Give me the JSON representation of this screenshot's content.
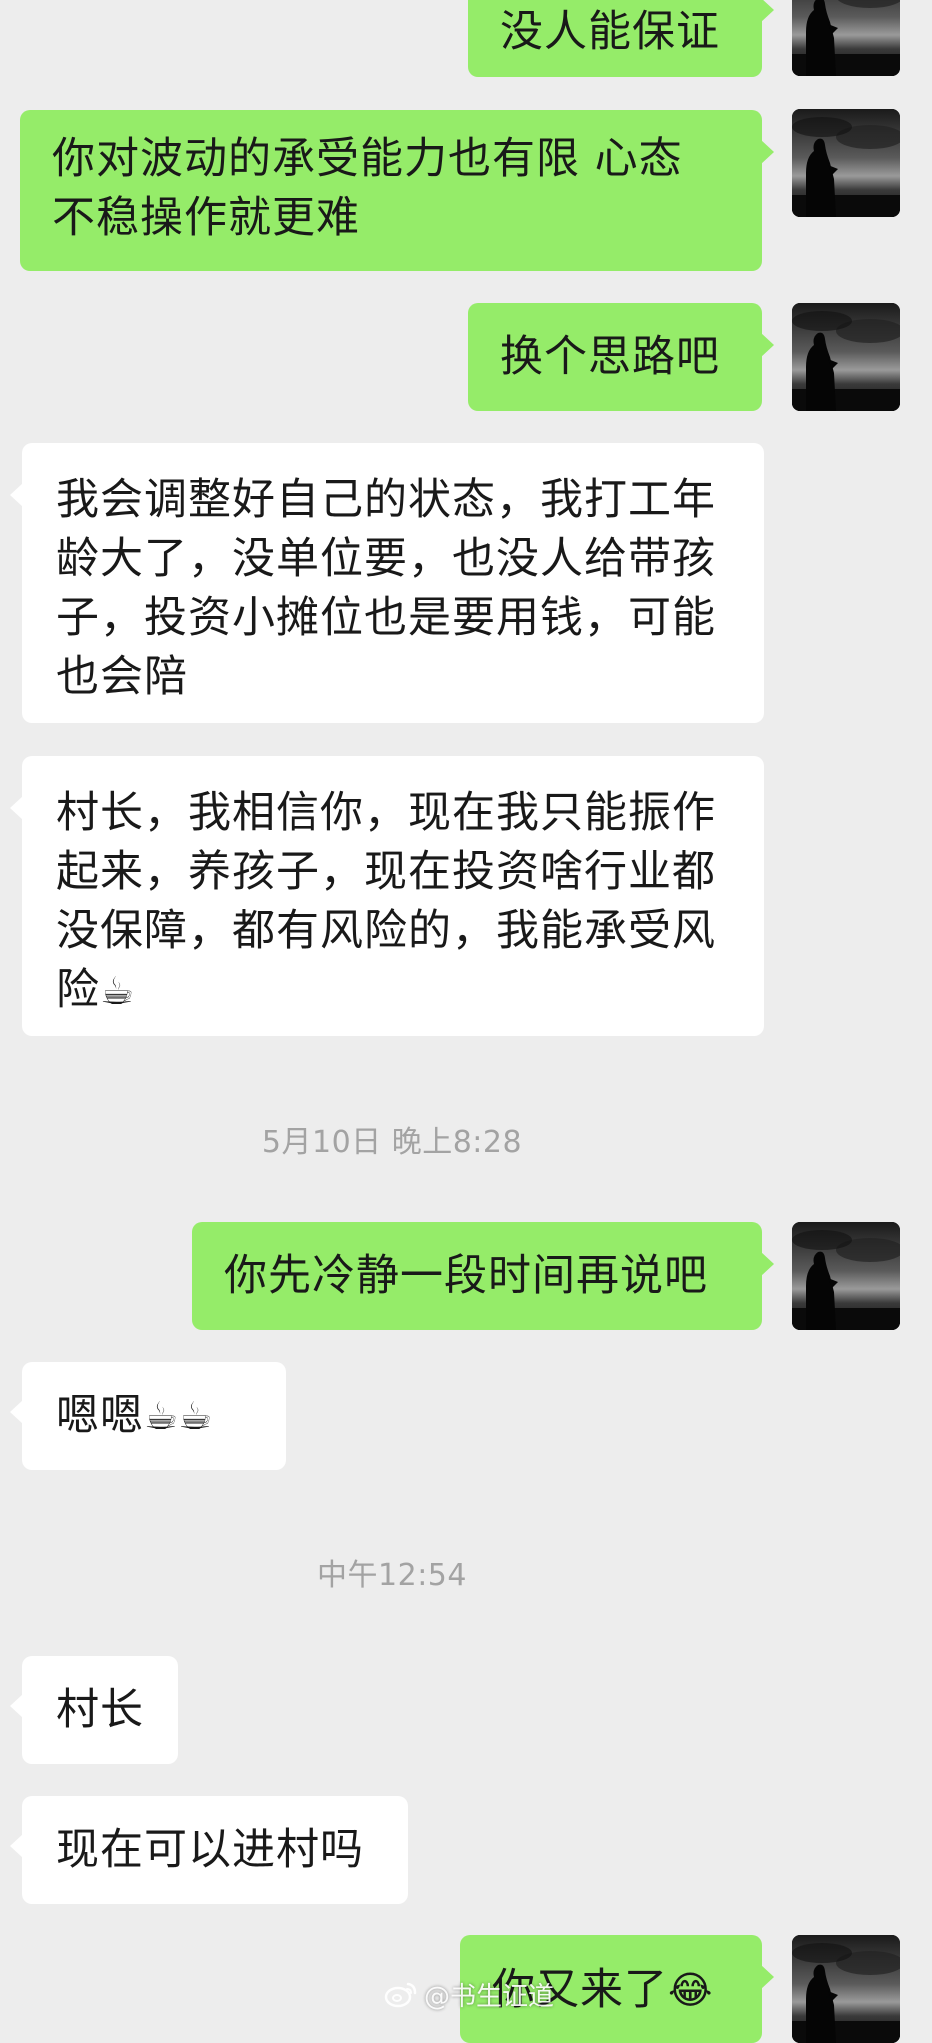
{
  "messages": {
    "m1": "没人能保证",
    "m2_line1": "你对波动的承受能力也有限 心态",
    "m2_line2": "不稳操作就更难",
    "m3": "换个思路吧",
    "m4_line1": "我会调整好自己的状态，我打工年",
    "m4_line2": "龄大了，没单位要，也没人给带孩",
    "m4_line3": "子，投资小摊位也是要用钱，可能",
    "m4_line4": "也会陪",
    "m5_line1": "村长，我相信你，现在我只能振作",
    "m5_line2": "起来，养孩子，现在投资啥行业都",
    "m5_line3": "没保障，都有风险的，我能承受风",
    "m5_line4": "险",
    "m5_emoji": "☕",
    "time1": "5月10日 晚上8:28",
    "m6": "你先冷静一段时间再说吧",
    "m7_text": "嗯嗯",
    "m7_emoji": "☕☕",
    "time2": "中午12:54",
    "m8": "村长",
    "m9": "现在可以进村吗",
    "m10_text": "你又来了",
    "m10_emoji": "😂"
  },
  "watermark": {
    "text": "@书生证道",
    "icon": "weibo-icon"
  },
  "colors": {
    "background": "#ededed",
    "sent_bubble": "#95ec69",
    "received_bubble": "#ffffff",
    "timestamp": "#a3a3a3"
  }
}
